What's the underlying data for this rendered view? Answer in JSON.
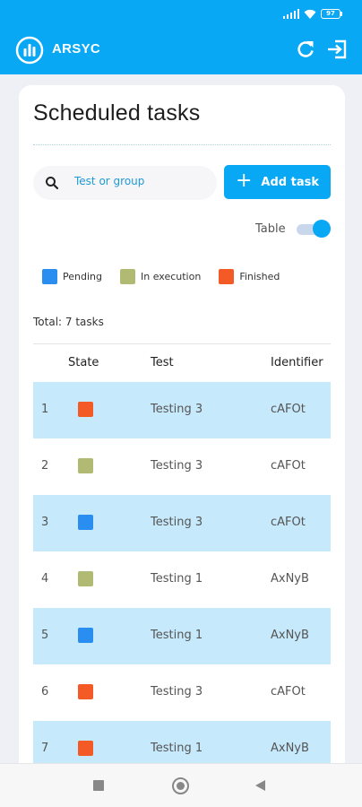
{
  "status_bar": {
    "battery": "97"
  },
  "app": {
    "brand": "ARSYC",
    "accent_color": "#08a8f5"
  },
  "page": {
    "title": "Scheduled tasks",
    "search_placeholder": "Test or group",
    "add_task_label": "Add task",
    "table_toggle_label": "Table",
    "table_toggle_on": true
  },
  "legend": [
    {
      "label": "Pending",
      "color": "#2a8ef0"
    },
    {
      "label": "In execution",
      "color": "#b1ba72"
    },
    {
      "label": "Finished",
      "color": "#f45a25"
    }
  ],
  "total_text": "Total: 7 tasks",
  "table": {
    "columns": [
      "State",
      "Test",
      "Identifier"
    ],
    "rows": [
      {
        "num": "1",
        "state": "Finished",
        "state_color": "#f45a25",
        "test": "Testing 3",
        "identifier": "cAFOt",
        "highlight": true
      },
      {
        "num": "2",
        "state": "In execution",
        "state_color": "#b1ba72",
        "test": "Testing 3",
        "identifier": "cAFOt",
        "highlight": false
      },
      {
        "num": "3",
        "state": "Pending",
        "state_color": "#2a8ef0",
        "test": "Testing 3",
        "identifier": "cAFOt",
        "highlight": true
      },
      {
        "num": "4",
        "state": "In execution",
        "state_color": "#b1ba72",
        "test": "Testing 1",
        "identifier": "AxNyB",
        "highlight": false
      },
      {
        "num": "5",
        "state": "Pending",
        "state_color": "#2a8ef0",
        "test": "Testing 1",
        "identifier": "AxNyB",
        "highlight": true
      },
      {
        "num": "6",
        "state": "Finished",
        "state_color": "#f45a25",
        "test": "Testing 3",
        "identifier": "cAFOt",
        "highlight": false
      },
      {
        "num": "7",
        "state": "Finished",
        "state_color": "#f45a25",
        "test": "Testing 1",
        "identifier": "AxNyB",
        "highlight": true
      }
    ]
  }
}
